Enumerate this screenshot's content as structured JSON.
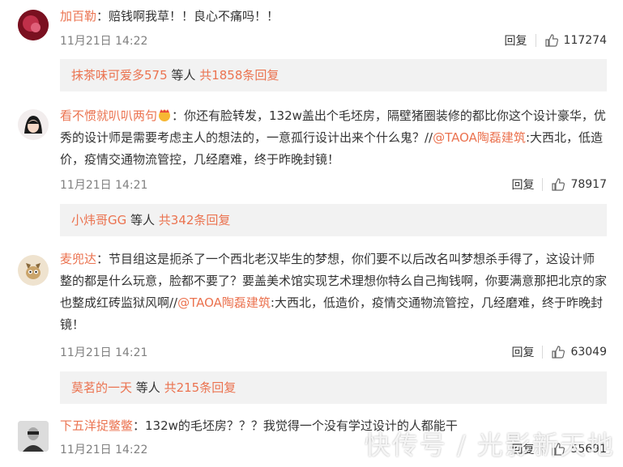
{
  "comments": [
    {
      "name": "加百勒",
      "text": "：赔钱啊我草！！良心不痛吗！！",
      "time": "11月21日 14:22",
      "reply_label": "回复",
      "likes": "117274",
      "replies": {
        "user": "抹茶味可爱多575",
        "mid": " 等人 ",
        "count": "共1858条回复"
      }
    },
    {
      "name": "看不惯就叭叭两句",
      "text": "：你还有脸转发，132w盖出个毛坯房，隔壁猪圈装修的都比你这个设计豪华，优秀的设计师是需要考虑主人的想法的，一意孤行设计出来个什么鬼？//",
      "mention": "@TAOA陶磊建筑",
      "text2": ":大西北，低造价，疫情交通物流管控，几经磨难，终于昨晚封镜！",
      "time": "11月21日 14:21",
      "reply_label": "回复",
      "likes": "78917",
      "replies": {
        "user": "小炜哥GG",
        "mid": " 等人 ",
        "count": "共342条回复"
      }
    },
    {
      "name": "麦兜达",
      "text": "：节目组这是扼杀了一个西北老汉毕生的梦想，你们要不以后改名叫梦想杀手得了，这设计师整的都是什么玩意，脸都不要了？要盖美术馆实现艺术理想你特么自己掏钱啊，你要满意那把北京的家也整成红砖监狱风啊//",
      "mention": "@TAOA陶磊建筑",
      "text2": ":大西北，低造价，疫情交通物流管控，几经磨难，终于昨晚封镜！",
      "time": "11月21日 14:21",
      "reply_label": "回复",
      "likes": "63049",
      "replies": {
        "user": "莫茗的一天",
        "mid": " 等人 ",
        "count": "共215条回复"
      }
    },
    {
      "name": "下五洋捉鳖鳖",
      "text": "：132w的毛坯房？？？我觉得一个没有学过设计的人都能干",
      "time": "11月21日 14:22",
      "reply_label": "回复",
      "likes": "55691"
    }
  ],
  "watermark": "快传号 / 光影新天地",
  "colors": {
    "accent": "#eb7350",
    "muted": "#808080",
    "reply_bg": "#f2f2f2"
  },
  "icons": {
    "like": "thumbs-up-icon"
  }
}
